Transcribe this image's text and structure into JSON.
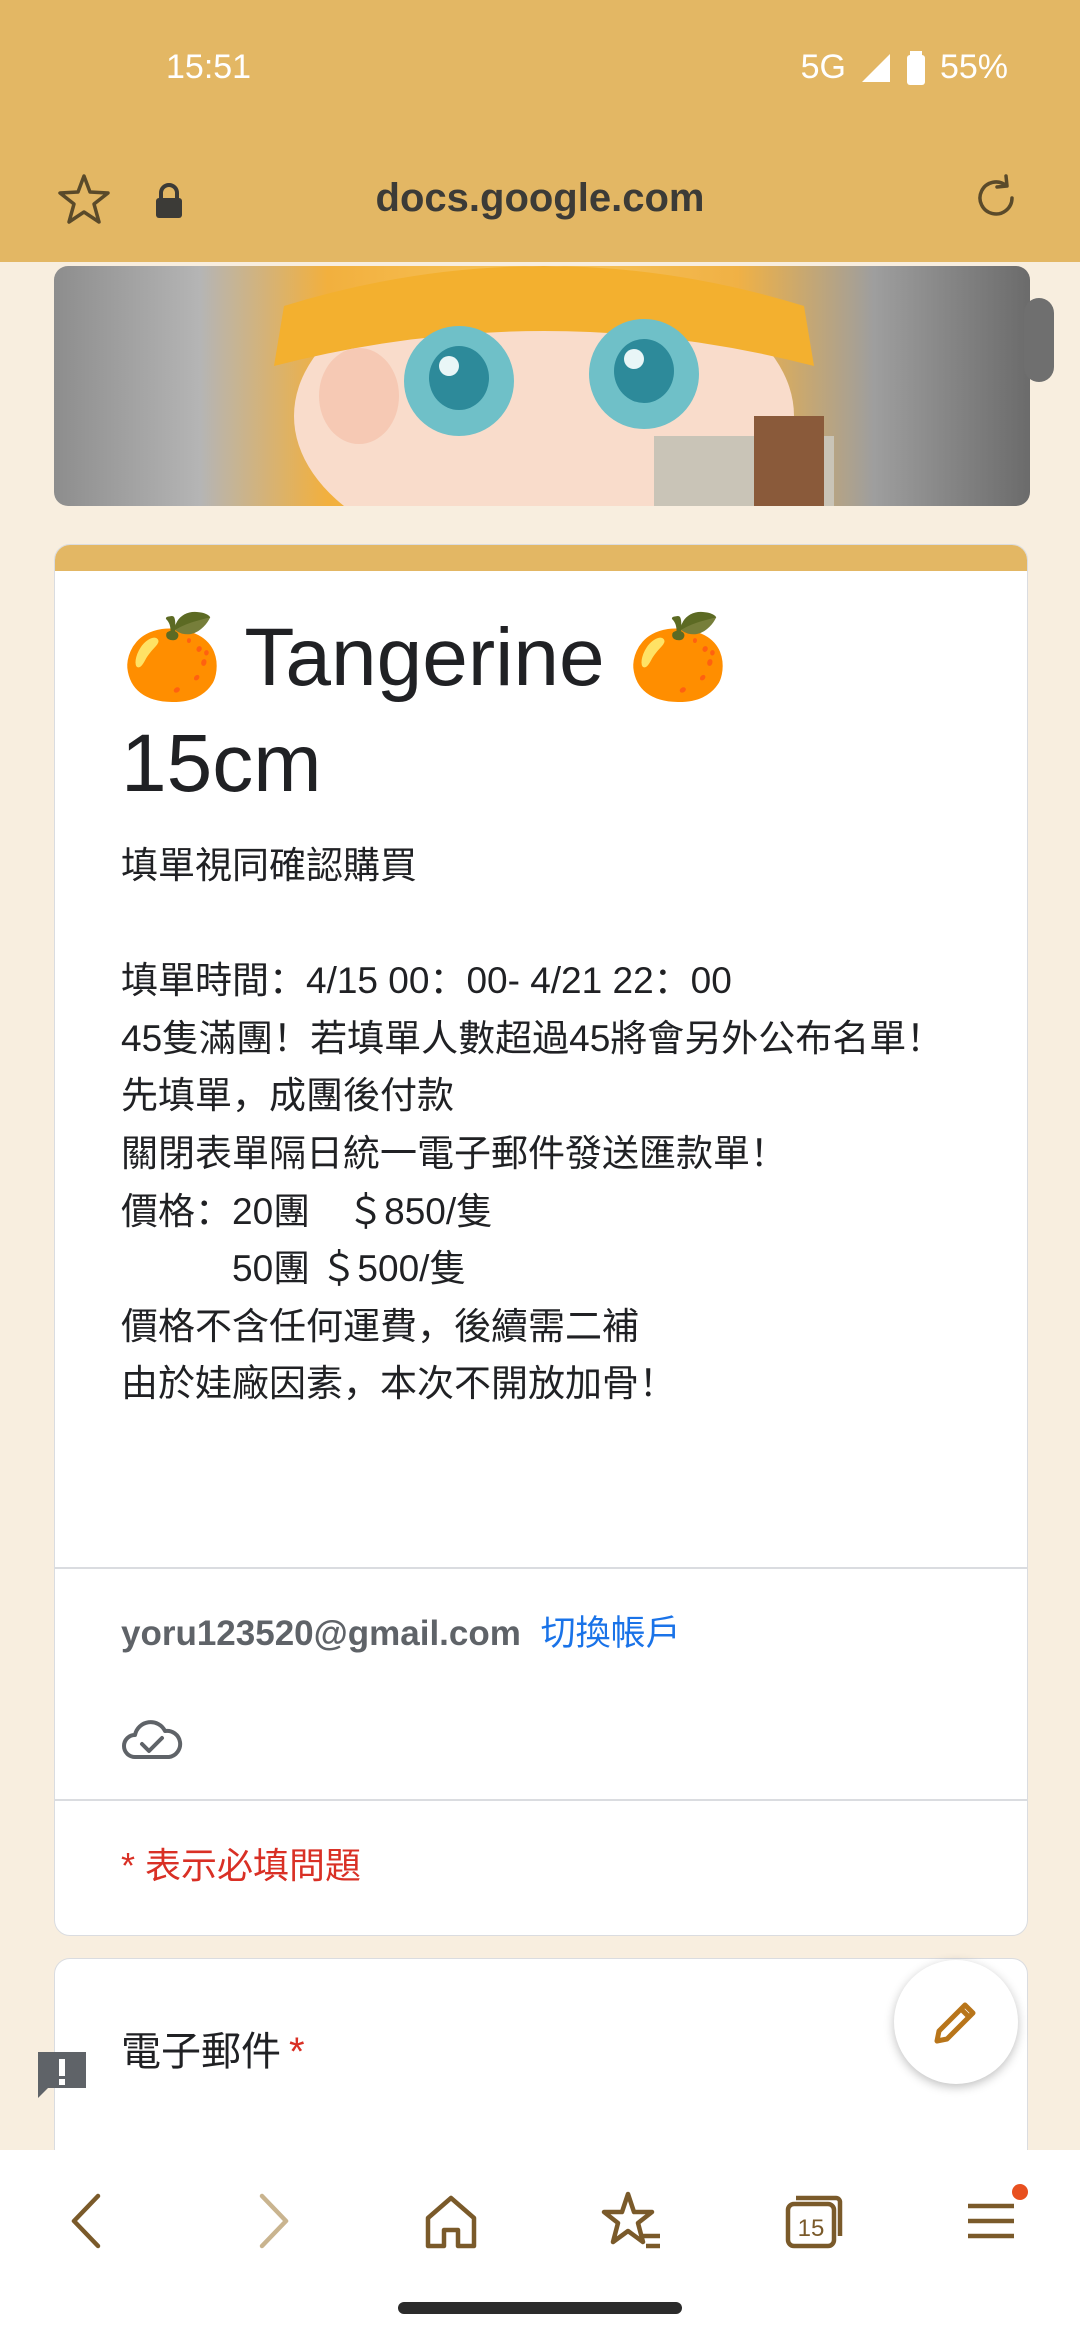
{
  "status_bar": {
    "time": "15:51",
    "network": "5G",
    "battery": "55%"
  },
  "browser": {
    "url": "docs.google.com"
  },
  "form": {
    "title_line1": "🍊 Tangerine 🍊",
    "title_line2": "15cm",
    "description": "填單視同確認購買\n\n填單時間：4/15 00：00- 4/21 22：00\n45隻滿團！若填單人數超過45將會另外公布名單！\n先填單，成團後付款\n關閉表單隔日統一電子郵件發送匯款單！\n價格：20團　＄850/隻\n　　　50團 ＄500/隻\n價格不含任何運費，後續需二補\n由於娃廠因素，本次不開放加骨！",
    "account_email": "yoru123520@gmail.com",
    "switch_account": "切換帳戶",
    "required_note": "* 表示必填問題",
    "question1_label": "電子郵件",
    "question1_required_mark": "*"
  },
  "bottom_nav": {
    "tabs_count": "15"
  },
  "colors": {
    "accent": "#e3b764",
    "link": "#1a73e8",
    "required": "#d93025"
  }
}
